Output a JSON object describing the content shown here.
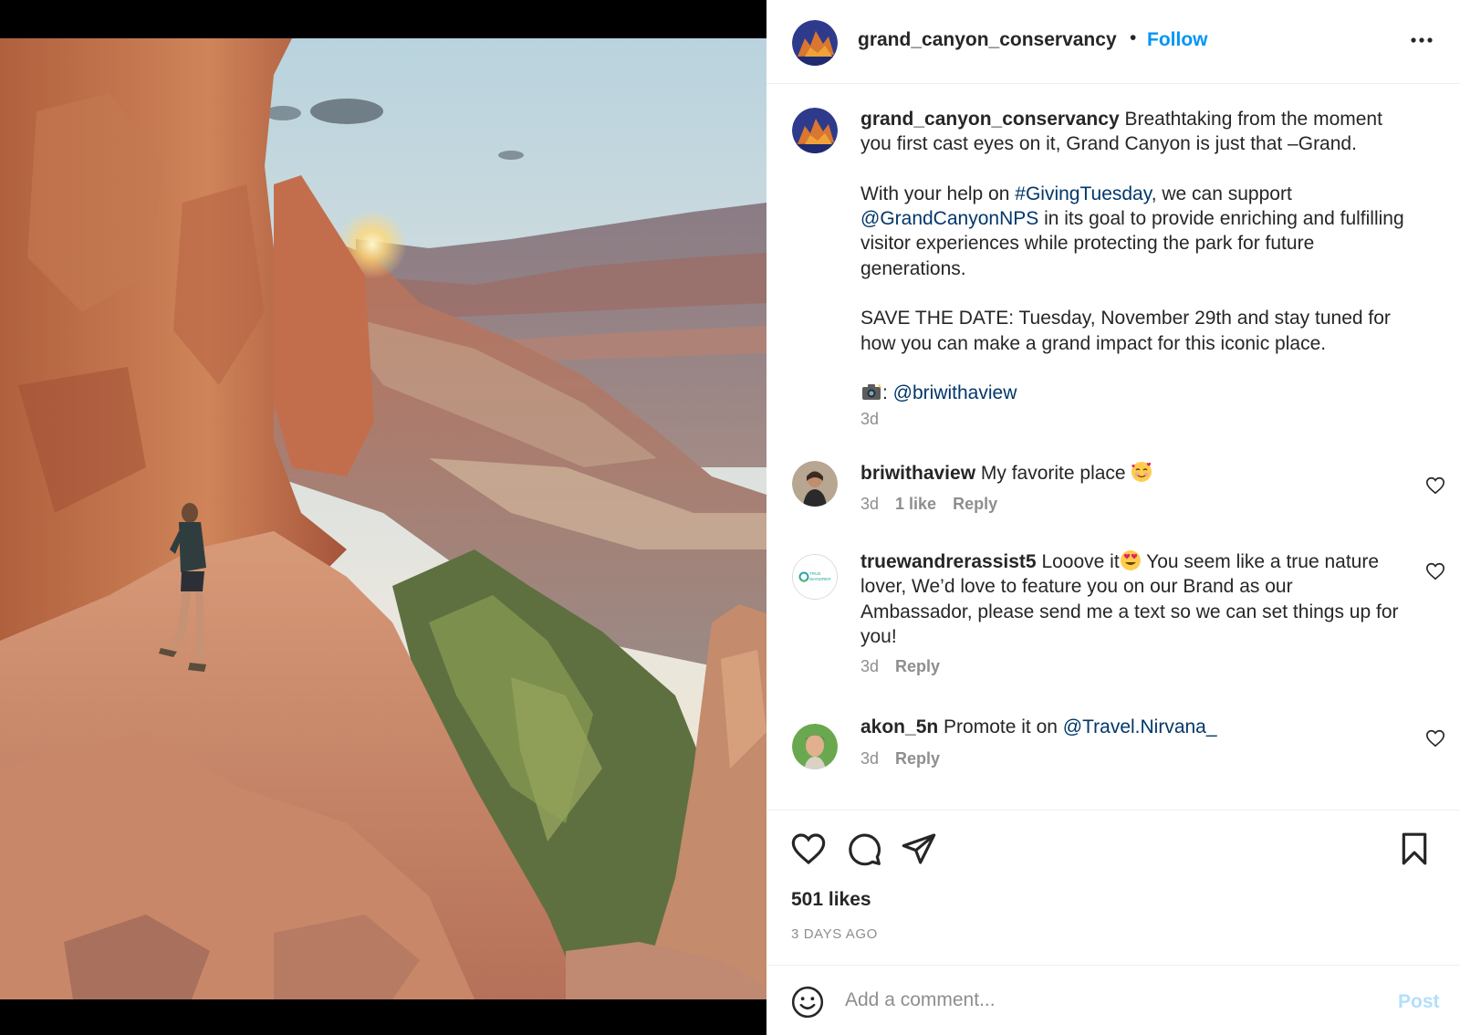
{
  "post": {
    "photo_alt": "Hiker on a red rock ledge overlooking a deep canyon at sunrise"
  },
  "header": {
    "username": "grand_canyon_conservancy",
    "separator": "•",
    "follow_label": "Follow",
    "more_icon": "more-horizontal-icon"
  },
  "caption": {
    "username": "grand_canyon_conservancy",
    "line1": "Breathtaking from the moment you first cast eyes on it, Grand Canyon is just that –Grand.",
    "p2_pre": "With your help on ",
    "p2_hashtag": "#GivingTuesday",
    "p2_mid": ", we can support ",
    "p2_mention": "@GrandCanyonNPS",
    "p2_post": " in its goal to provide enriching and fulfilling visitor experiences while protecting the park for future generations.",
    "p3": "SAVE THE DATE: Tuesday, November 29th and stay tuned for how you can make a grand impact for this iconic place.",
    "credit_sep": ": ",
    "credit_mention": "@briwithaview",
    "time": "3d"
  },
  "comments": [
    {
      "username": "briwithaview",
      "text": "My favorite place ",
      "emoji": "smiling-face-with-hearts",
      "time": "3d",
      "likes": "1 like",
      "reply": "Reply"
    },
    {
      "username": "truewandrerassist5",
      "text_a": "Looove it",
      "emoji": "heart-eyes",
      "text_b": " You seem like a true nature lover, We’d love to feature you on our Brand as our Ambassador, please send me a text so we can set things up for you!",
      "avatar_text": "TRUE WANDRER",
      "time": "3d",
      "reply": "Reply"
    },
    {
      "username": "akon_5n",
      "text": "Promote it on ",
      "mention": "@Travel.Nirvana_",
      "time": "3d",
      "reply": "Reply"
    }
  ],
  "actions": {
    "likes": "501 likes",
    "date": "3 DAYS AGO"
  },
  "add_comment": {
    "placeholder": "Add a comment...",
    "post_label": "Post"
  },
  "colors": {
    "accent": "#0095f6",
    "link": "#00376b",
    "muted": "#8e8e8e",
    "post_disabled": "#b2dffc"
  }
}
